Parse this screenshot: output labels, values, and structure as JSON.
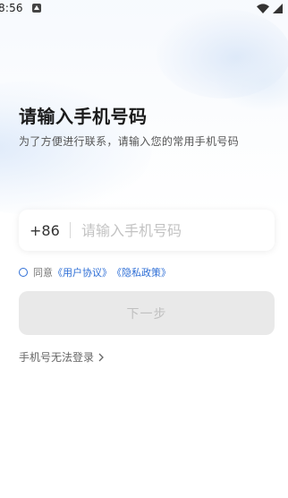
{
  "status_bar": {
    "time": "8:56"
  },
  "header": {
    "title": "请输入手机号码",
    "subtitle": "为了方便进行联系，请输入您的常用手机号码"
  },
  "phone": {
    "country_code": "+86",
    "placeholder": "请输入手机号码",
    "value": ""
  },
  "agreement": {
    "prefix": "同意",
    "user_agreement": "《用户协议》",
    "privacy_policy": "《隐私政策》"
  },
  "next_button": {
    "label": "下一步"
  },
  "cannot_login": {
    "label": "手机号无法登录"
  },
  "colors": {
    "accent": "#2f6fd6",
    "button_disabled_bg": "#e9e9e9",
    "button_disabled_text": "#c0c0c0"
  },
  "icons": [
    "notification-icon",
    "wifi-icon",
    "signal-icon",
    "radio-icon",
    "chevron-right-icon"
  ]
}
